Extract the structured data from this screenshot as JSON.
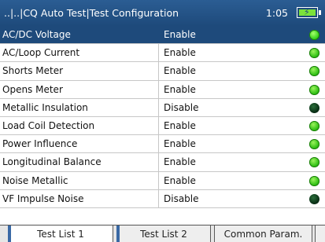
{
  "header": {
    "title": "..|..|CQ Auto Test|Test Configuration",
    "clock": "1:05"
  },
  "rows": [
    {
      "name": "AC/DC Voltage",
      "value": "Enable",
      "status": "on"
    },
    {
      "name": "AC/Loop Current",
      "value": "Enable",
      "status": "on"
    },
    {
      "name": "Shorts Meter",
      "value": "Enable",
      "status": "on"
    },
    {
      "name": "Opens Meter",
      "value": "Enable",
      "status": "on"
    },
    {
      "name": "Metallic Insulation",
      "value": "Disable",
      "status": "off"
    },
    {
      "name": "Load Coil Detection",
      "value": "Enable",
      "status": "on"
    },
    {
      "name": "Power Influence",
      "value": "Enable",
      "status": "on"
    },
    {
      "name": "Longitudinal Balance",
      "value": "Enable",
      "status": "on"
    },
    {
      "name": "Noise Metallic",
      "value": "Enable",
      "status": "on"
    },
    {
      "name": "VF Impulse Noise",
      "value": "Disable",
      "status": "off"
    }
  ],
  "selected_row": 0,
  "tabs": [
    {
      "label": "Test List 1",
      "active": true
    },
    {
      "label": "Test List 2",
      "active": false
    },
    {
      "label": "Common Param.",
      "active": false
    }
  ],
  "colors": {
    "header_bg": "#1e4a7b",
    "led_on": "#2fbf14",
    "led_off": "#0c3318"
  },
  "icons": {
    "battery": "battery-charging-icon",
    "status_on": "green-led-icon",
    "status_off": "dark-led-icon"
  }
}
